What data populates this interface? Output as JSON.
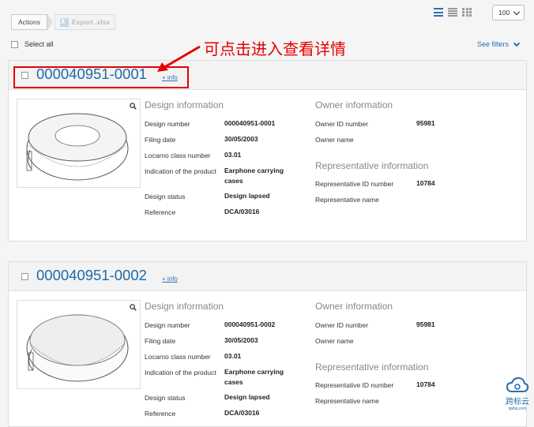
{
  "toolbar": {
    "actions_label": "Actions",
    "export_label": "Export .xlsx"
  },
  "per_page": {
    "value": "100"
  },
  "select_all_label": "Select all",
  "see_filters_label": "See filters",
  "more_info_label": "+ info",
  "annotation": {
    "text": "可点击进入查看详情"
  },
  "watermark": {
    "name": "跨标云",
    "url": "ipkbq.com"
  },
  "labels": {
    "design_info_title": "Design information",
    "owner_info_title": "Owner information",
    "rep_info_title": "Representative information",
    "design_number": "Design number",
    "filing_date": "Filing date",
    "locarno": "Locarno class number",
    "product": "Indication of the product",
    "status": "Design status",
    "reference": "Reference",
    "owner_id": "Owner ID number",
    "owner_name": "Owner name",
    "rep_id": "Representative ID number",
    "rep_name": "Representative name"
  },
  "results": [
    {
      "design_number": "000040951-0001",
      "filing_date": "30/05/2003",
      "locarno": "03.01",
      "product": "Earphone carrying cases",
      "status": "Design lapsed",
      "reference": "DCA/03016",
      "owner_id": "95981",
      "rep_id": "10784"
    },
    {
      "design_number": "000040951-0002",
      "filing_date": "30/05/2003",
      "locarno": "03.01",
      "product": "Earphone carrying cases",
      "status": "Design lapsed",
      "reference": "DCA/03016",
      "owner_id": "95981",
      "rep_id": "10784"
    }
  ]
}
